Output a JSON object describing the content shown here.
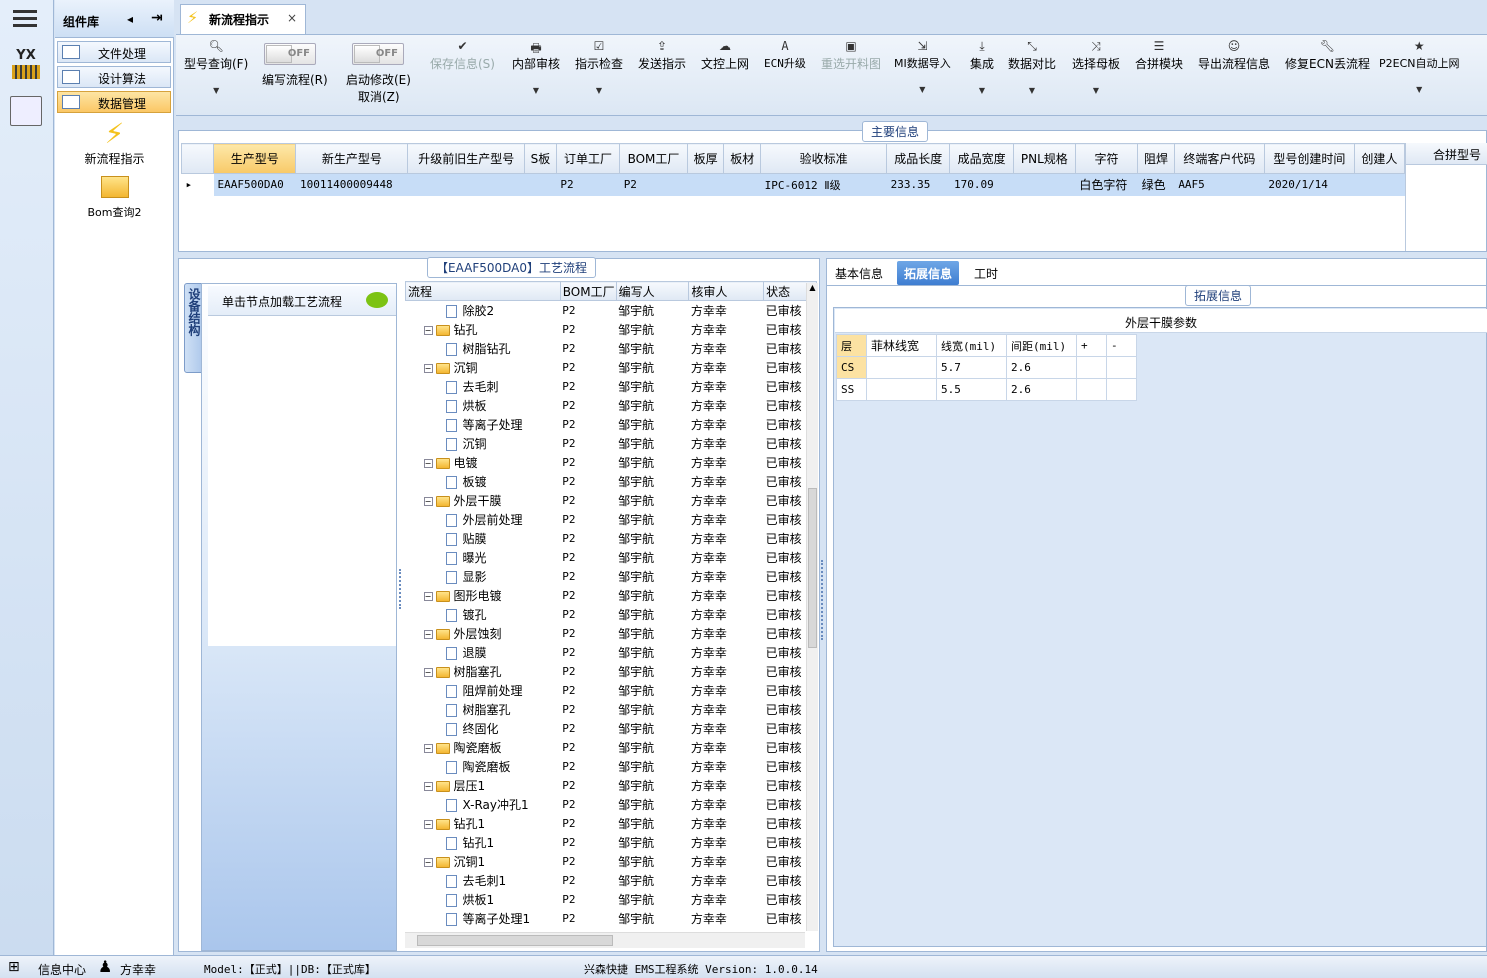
{
  "sidebar": {
    "logo_text": "YX"
  },
  "component_panel": {
    "title": "组件库",
    "items": [
      {
        "label": "文件处理"
      },
      {
        "label": "设计算法"
      },
      {
        "label": "数据管理"
      }
    ],
    "launchers": [
      {
        "label": "新流程指示"
      },
      {
        "label": "Bom查询2"
      }
    ]
  },
  "doc_tab": {
    "title": "新流程指示",
    "close": "×"
  },
  "toolbar": {
    "query": "型号查询(F)",
    "edit_flow": "编写流程(R)",
    "start_edit": "启动修改(E)",
    "cancel": "取消(Z)",
    "toggle_off": "OFF",
    "save": "保存信息(S)",
    "internal_audit": "内部审核",
    "check": "指示检查",
    "send": "发送指示",
    "upload": "文控上网",
    "ecn": "ECN升级",
    "reselect": "重选开料图",
    "mi_import": "MI数据导入",
    "integrate": "集成",
    "compare": "数据对比",
    "select_template": "选择母板",
    "merge": "合拼模块",
    "export": "导出流程信息",
    "fix_ecn": "修复ECN丢流程",
    "p2ecn": "P2ECN自动上网"
  },
  "main_info": {
    "title": "主要信息",
    "columns": [
      "生产型号",
      "新生产型号",
      "升级前旧生产型号",
      "S板",
      "订单工厂",
      "BOM工厂",
      "板厚",
      "板材",
      "验收标准",
      "成品长度",
      "成品宽度",
      "PNL规格",
      "字符",
      "阻焊",
      "终端客户代码",
      "型号创建时间",
      "创建人"
    ],
    "row": [
      "EAAF500DA0",
      "10011400009448",
      "",
      "",
      "P2",
      "P2",
      "",
      "",
      "IPC-6012 Ⅱ级",
      "233.35",
      "170.09",
      "",
      "白色字符",
      "绿色",
      "AAF5",
      "2020/1/14",
      ""
    ],
    "side_column": "合拼型号"
  },
  "flow_panel": {
    "title": "【EAAF500DA0】工艺流程",
    "side_tab": "设备结构",
    "hint": "单击节点加载工艺流程",
    "columns": [
      "流程",
      "BOM工厂",
      "编写人",
      "核审人",
      "状态"
    ],
    "rows": [
      {
        "name": "除胶2",
        "level": 2,
        "type": "file",
        "factory": "P2",
        "writer": "邹宇航",
        "reviewer": "方幸幸",
        "status": "已审核"
      },
      {
        "name": "钻孔",
        "level": 1,
        "type": "folder",
        "factory": "P2",
        "writer": "邹宇航",
        "reviewer": "方幸幸",
        "status": "已审核"
      },
      {
        "name": "树脂钻孔",
        "level": 2,
        "type": "file",
        "factory": "P2",
        "writer": "邹宇航",
        "reviewer": "方幸幸",
        "status": "已审核"
      },
      {
        "name": "沉铜",
        "level": 1,
        "type": "folder",
        "factory": "P2",
        "writer": "邹宇航",
        "reviewer": "方幸幸",
        "status": "已审核"
      },
      {
        "name": "去毛刺",
        "level": 2,
        "type": "file",
        "factory": "P2",
        "writer": "邹宇航",
        "reviewer": "方幸幸",
        "status": "已审核"
      },
      {
        "name": "烘板",
        "level": 2,
        "type": "file",
        "factory": "P2",
        "writer": "邹宇航",
        "reviewer": "方幸幸",
        "status": "已审核"
      },
      {
        "name": "等离子处理",
        "level": 2,
        "type": "file",
        "factory": "P2",
        "writer": "邹宇航",
        "reviewer": "方幸幸",
        "status": "已审核"
      },
      {
        "name": "沉铜",
        "level": 2,
        "type": "file",
        "factory": "P2",
        "writer": "邹宇航",
        "reviewer": "方幸幸",
        "status": "已审核"
      },
      {
        "name": "电镀",
        "level": 1,
        "type": "folder",
        "factory": "P2",
        "writer": "邹宇航",
        "reviewer": "方幸幸",
        "status": "已审核"
      },
      {
        "name": "板镀",
        "level": 2,
        "type": "file",
        "factory": "P2",
        "writer": "邹宇航",
        "reviewer": "方幸幸",
        "status": "已审核"
      },
      {
        "name": "外层干膜",
        "level": 1,
        "type": "folder",
        "factory": "P2",
        "writer": "邹宇航",
        "reviewer": "方幸幸",
        "status": "已审核"
      },
      {
        "name": "外层前处理",
        "level": 2,
        "type": "file",
        "factory": "P2",
        "writer": "邹宇航",
        "reviewer": "方幸幸",
        "status": "已审核"
      },
      {
        "name": "贴膜",
        "level": 2,
        "type": "file",
        "factory": "P2",
        "writer": "邹宇航",
        "reviewer": "方幸幸",
        "status": "已审核"
      },
      {
        "name": "曝光",
        "level": 2,
        "type": "file",
        "factory": "P2",
        "writer": "邹宇航",
        "reviewer": "方幸幸",
        "status": "已审核"
      },
      {
        "name": "显影",
        "level": 2,
        "type": "file",
        "factory": "P2",
        "writer": "邹宇航",
        "reviewer": "方幸幸",
        "status": "已审核"
      },
      {
        "name": "图形电镀",
        "level": 1,
        "type": "folder",
        "factory": "P2",
        "writer": "邹宇航",
        "reviewer": "方幸幸",
        "status": "已审核"
      },
      {
        "name": "镀孔",
        "level": 2,
        "type": "file",
        "factory": "P2",
        "writer": "邹宇航",
        "reviewer": "方幸幸",
        "status": "已审核"
      },
      {
        "name": "外层蚀刻",
        "level": 1,
        "type": "folder",
        "factory": "P2",
        "writer": "邹宇航",
        "reviewer": "方幸幸",
        "status": "已审核"
      },
      {
        "name": "退膜",
        "level": 2,
        "type": "file",
        "factory": "P2",
        "writer": "邹宇航",
        "reviewer": "方幸幸",
        "status": "已审核"
      },
      {
        "name": "树脂塞孔",
        "level": 1,
        "type": "folder",
        "factory": "P2",
        "writer": "邹宇航",
        "reviewer": "方幸幸",
        "status": "已审核"
      },
      {
        "name": "阻焊前处理",
        "level": 2,
        "type": "file",
        "factory": "P2",
        "writer": "邹宇航",
        "reviewer": "方幸幸",
        "status": "已审核"
      },
      {
        "name": "树脂塞孔",
        "level": 2,
        "type": "file",
        "factory": "P2",
        "writer": "邹宇航",
        "reviewer": "方幸幸",
        "status": "已审核"
      },
      {
        "name": "终固化",
        "level": 2,
        "type": "file",
        "factory": "P2",
        "writer": "邹宇航",
        "reviewer": "方幸幸",
        "status": "已审核"
      },
      {
        "name": "陶瓷磨板",
        "level": 1,
        "type": "folder",
        "factory": "P2",
        "writer": "邹宇航",
        "reviewer": "方幸幸",
        "status": "已审核"
      },
      {
        "name": "陶瓷磨板",
        "level": 2,
        "type": "file",
        "factory": "P2",
        "writer": "邹宇航",
        "reviewer": "方幸幸",
        "status": "已审核"
      },
      {
        "name": "层压1",
        "level": 1,
        "type": "folder",
        "factory": "P2",
        "writer": "邹宇航",
        "reviewer": "方幸幸",
        "status": "已审核"
      },
      {
        "name": "X-Ray冲孔1",
        "level": 2,
        "type": "file",
        "factory": "P2",
        "writer": "邹宇航",
        "reviewer": "方幸幸",
        "status": "已审核"
      },
      {
        "name": "钻孔1",
        "level": 1,
        "type": "folder",
        "factory": "P2",
        "writer": "邹宇航",
        "reviewer": "方幸幸",
        "status": "已审核"
      },
      {
        "name": "钻孔1",
        "level": 2,
        "type": "file",
        "factory": "P2",
        "writer": "邹宇航",
        "reviewer": "方幸幸",
        "status": "已审核"
      },
      {
        "name": "沉铜1",
        "level": 1,
        "type": "folder",
        "factory": "P2",
        "writer": "邹宇航",
        "reviewer": "方幸幸",
        "status": "已审核"
      },
      {
        "name": "去毛刺1",
        "level": 2,
        "type": "file",
        "factory": "P2",
        "writer": "邹宇航",
        "reviewer": "方幸幸",
        "status": "已审核"
      },
      {
        "name": "烘板1",
        "level": 2,
        "type": "file",
        "factory": "P2",
        "writer": "邹宇航",
        "reviewer": "方幸幸",
        "status": "已审核"
      },
      {
        "name": "等离子处理1",
        "level": 2,
        "type": "file",
        "factory": "P2",
        "writer": "邹宇航",
        "reviewer": "方幸幸",
        "status": "已审核"
      }
    ]
  },
  "detail_panel": {
    "tabs": [
      {
        "label": "基本信息"
      },
      {
        "label": "拓展信息",
        "active": true
      },
      {
        "label": "工时"
      }
    ],
    "group_title": "拓展信息",
    "grid_title": "外层干膜参数",
    "columns": [
      "层",
      "菲林线宽",
      "线宽(mil)",
      "间距(mil)",
      "+",
      "-"
    ],
    "rows": [
      [
        "CS",
        "",
        "5.7",
        "2.6",
        "",
        ""
      ],
      [
        "SS",
        "",
        "5.5",
        "2.6",
        "",
        ""
      ]
    ]
  },
  "status_bar": {
    "info_center": "信息中心",
    "user": "方幸幸",
    "model": "Model:【正式】||DB:【正式库】",
    "system": "兴森快捷 EMS工程系统 Version: 1.0.0.14"
  }
}
